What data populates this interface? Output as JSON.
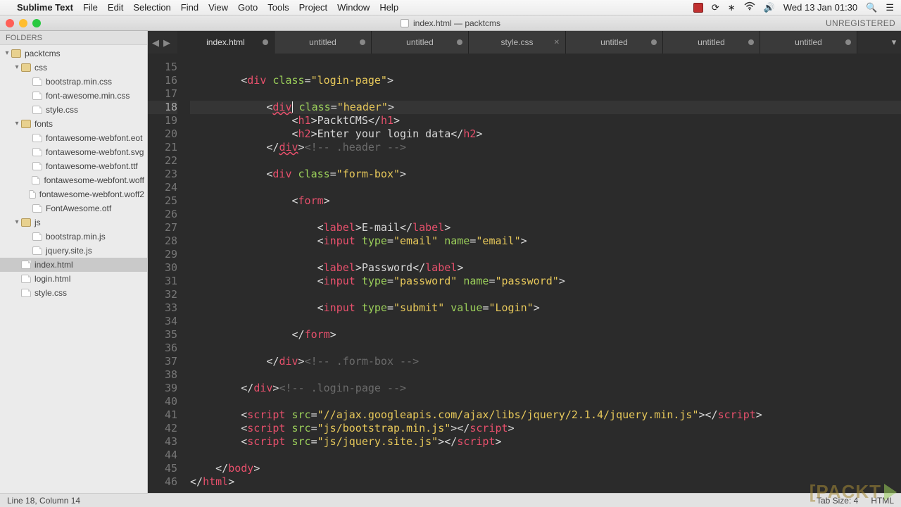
{
  "menubar": {
    "app": "Sublime Text",
    "items": [
      "File",
      "Edit",
      "Selection",
      "Find",
      "View",
      "Goto",
      "Tools",
      "Project",
      "Window",
      "Help"
    ],
    "clock": "Wed 13 Jan  01:30"
  },
  "window": {
    "title": "index.html — packtcms",
    "unregistered": "UNREGISTERED"
  },
  "sidebar": {
    "header": "FOLDERS",
    "tree": [
      {
        "depth": 0,
        "type": "folder",
        "arrow": "open",
        "name": "packtcms"
      },
      {
        "depth": 1,
        "type": "folder",
        "arrow": "open",
        "name": "css"
      },
      {
        "depth": 2,
        "type": "file",
        "name": "bootstrap.min.css"
      },
      {
        "depth": 2,
        "type": "file",
        "name": "font-awesome.min.css"
      },
      {
        "depth": 2,
        "type": "file",
        "name": "style.css"
      },
      {
        "depth": 1,
        "type": "folder",
        "arrow": "open",
        "name": "fonts"
      },
      {
        "depth": 2,
        "type": "file",
        "name": "fontawesome-webfont.eot"
      },
      {
        "depth": 2,
        "type": "file",
        "name": "fontawesome-webfont.svg"
      },
      {
        "depth": 2,
        "type": "file",
        "name": "fontawesome-webfont.ttf"
      },
      {
        "depth": 2,
        "type": "file",
        "name": "fontawesome-webfont.woff"
      },
      {
        "depth": 2,
        "type": "file",
        "name": "fontawesome-webfont.woff2"
      },
      {
        "depth": 2,
        "type": "file",
        "name": "FontAwesome.otf"
      },
      {
        "depth": 1,
        "type": "folder",
        "arrow": "open",
        "name": "js"
      },
      {
        "depth": 2,
        "type": "file",
        "name": "bootstrap.min.js"
      },
      {
        "depth": 2,
        "type": "file",
        "name": "jquery.site.js"
      },
      {
        "depth": 1,
        "type": "file",
        "name": "index.html",
        "selected": true
      },
      {
        "depth": 1,
        "type": "file",
        "name": "login.html"
      },
      {
        "depth": 1,
        "type": "file",
        "name": "style.css"
      }
    ]
  },
  "tabs": [
    {
      "label": "index.html",
      "state": "dirty",
      "active": true
    },
    {
      "label": "untitled",
      "state": "dirty"
    },
    {
      "label": "untitled",
      "state": "dirty"
    },
    {
      "label": "style.css",
      "state": "close"
    },
    {
      "label": "untitled",
      "state": "dirty"
    },
    {
      "label": "untitled",
      "state": "dirty"
    },
    {
      "label": "untitled",
      "state": "dirty"
    }
  ],
  "code": {
    "first_line": 15,
    "highlighted_line": 18,
    "lines": [
      [],
      [
        [
          "p",
          "        <"
        ],
        [
          "t",
          "div"
        ],
        [
          "p",
          " "
        ],
        [
          "a",
          "class"
        ],
        [
          "p",
          "="
        ],
        [
          "s",
          "\"login-page\""
        ],
        [
          "p",
          ">"
        ]
      ],
      [],
      [
        [
          "p",
          "            <"
        ],
        [
          "te",
          "div"
        ],
        [
          "cursor",
          ""
        ],
        [
          "p",
          " "
        ],
        [
          "a",
          "class"
        ],
        [
          "p",
          "="
        ],
        [
          "s",
          "\"header\""
        ],
        [
          "p",
          ">"
        ]
      ],
      [
        [
          "p",
          "                <"
        ],
        [
          "t",
          "h1"
        ],
        [
          "p",
          ">PacktCMS</"
        ],
        [
          "t",
          "h1"
        ],
        [
          "p",
          ">"
        ]
      ],
      [
        [
          "p",
          "                <"
        ],
        [
          "t",
          "h2"
        ],
        [
          "p",
          ">Enter your login data</"
        ],
        [
          "t",
          "h2"
        ],
        [
          "p",
          ">"
        ]
      ],
      [
        [
          "p",
          "            </"
        ],
        [
          "te",
          "div"
        ],
        [
          "p",
          ">"
        ],
        [
          "c",
          "<!-- .header -->"
        ]
      ],
      [],
      [
        [
          "p",
          "            <"
        ],
        [
          "t",
          "div"
        ],
        [
          "p",
          " "
        ],
        [
          "a",
          "class"
        ],
        [
          "p",
          "="
        ],
        [
          "s",
          "\"form-box\""
        ],
        [
          "p",
          ">"
        ]
      ],
      [],
      [
        [
          "p",
          "                <"
        ],
        [
          "t",
          "form"
        ],
        [
          "p",
          ">"
        ]
      ],
      [],
      [
        [
          "p",
          "                    <"
        ],
        [
          "t",
          "label"
        ],
        [
          "p",
          ">E-mail</"
        ],
        [
          "t",
          "label"
        ],
        [
          "p",
          ">"
        ]
      ],
      [
        [
          "p",
          "                    <"
        ],
        [
          "t",
          "input"
        ],
        [
          "p",
          " "
        ],
        [
          "a",
          "type"
        ],
        [
          "p",
          "="
        ],
        [
          "s",
          "\"email\""
        ],
        [
          "p",
          " "
        ],
        [
          "a",
          "name"
        ],
        [
          "p",
          "="
        ],
        [
          "s",
          "\"email\""
        ],
        [
          "p",
          ">"
        ]
      ],
      [],
      [
        [
          "p",
          "                    <"
        ],
        [
          "t",
          "label"
        ],
        [
          "p",
          ">Password</"
        ],
        [
          "t",
          "label"
        ],
        [
          "p",
          ">"
        ]
      ],
      [
        [
          "p",
          "                    <"
        ],
        [
          "t",
          "input"
        ],
        [
          "p",
          " "
        ],
        [
          "a",
          "type"
        ],
        [
          "p",
          "="
        ],
        [
          "s",
          "\"password\""
        ],
        [
          "p",
          " "
        ],
        [
          "a",
          "name"
        ],
        [
          "p",
          "="
        ],
        [
          "s",
          "\"password\""
        ],
        [
          "p",
          ">"
        ]
      ],
      [],
      [
        [
          "p",
          "                    <"
        ],
        [
          "t",
          "input"
        ],
        [
          "p",
          " "
        ],
        [
          "a",
          "type"
        ],
        [
          "p",
          "="
        ],
        [
          "s",
          "\"submit\""
        ],
        [
          "p",
          " "
        ],
        [
          "a",
          "value"
        ],
        [
          "p",
          "="
        ],
        [
          "s",
          "\"Login\""
        ],
        [
          "p",
          ">"
        ]
      ],
      [],
      [
        [
          "p",
          "                </"
        ],
        [
          "t",
          "form"
        ],
        [
          "p",
          ">"
        ]
      ],
      [],
      [
        [
          "p",
          "            </"
        ],
        [
          "t",
          "div"
        ],
        [
          "p",
          ">"
        ],
        [
          "c",
          "<!-- .form-box -->"
        ]
      ],
      [],
      [
        [
          "p",
          "        </"
        ],
        [
          "t",
          "div"
        ],
        [
          "p",
          ">"
        ],
        [
          "c",
          "<!-- .login-page -->"
        ]
      ],
      [],
      [
        [
          "p",
          "        <"
        ],
        [
          "t",
          "script"
        ],
        [
          "p",
          " "
        ],
        [
          "a",
          "src"
        ],
        [
          "p",
          "="
        ],
        [
          "s",
          "\"//ajax.googleapis.com/ajax/libs/jquery/2.1.4/jquery.min.js\""
        ],
        [
          "p",
          "></"
        ],
        [
          "t",
          "script"
        ],
        [
          "p",
          ">"
        ]
      ],
      [
        [
          "p",
          "        <"
        ],
        [
          "t",
          "script"
        ],
        [
          "p",
          " "
        ],
        [
          "a",
          "src"
        ],
        [
          "p",
          "="
        ],
        [
          "s",
          "\"js/bootstrap.min.js\""
        ],
        [
          "p",
          "></"
        ],
        [
          "t",
          "script"
        ],
        [
          "p",
          ">"
        ]
      ],
      [
        [
          "p",
          "        <"
        ],
        [
          "t",
          "script"
        ],
        [
          "p",
          " "
        ],
        [
          "a",
          "src"
        ],
        [
          "p",
          "="
        ],
        [
          "s",
          "\"js/jquery.site.js\""
        ],
        [
          "p",
          "></"
        ],
        [
          "t",
          "script"
        ],
        [
          "p",
          ">"
        ]
      ],
      [],
      [
        [
          "p",
          "    </"
        ],
        [
          "t",
          "body"
        ],
        [
          "p",
          ">"
        ]
      ],
      [
        [
          "p",
          "</"
        ],
        [
          "t",
          "html"
        ],
        [
          "p",
          ">"
        ]
      ]
    ]
  },
  "status": {
    "left": "Line 18, Column 14",
    "tab_size": "Tab Size: 4",
    "syntax": "HTML"
  },
  "badge": "[PACKT"
}
